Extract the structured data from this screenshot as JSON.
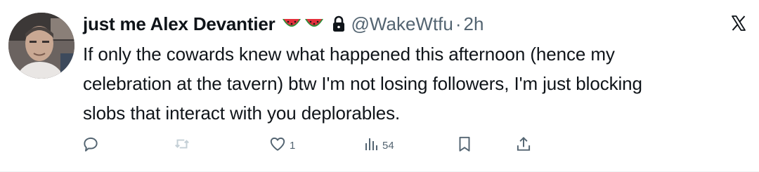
{
  "tweet": {
    "author": {
      "display_name": "just me Alex Devantier",
      "badges": [
        "watermelon-icon",
        "watermelon-icon"
      ],
      "protected_icon": "lock-icon",
      "handle": "@WakeWtfu",
      "separator": "·",
      "time": "2h"
    },
    "body_lines": [
      "If only the cowards knew what happened this afternoon (hence my",
      "celebration at the tavern) btw I'm not losing followers, I'm just blocking",
      "slobs that interact with you deplorables."
    ],
    "actions": {
      "reply": {
        "icon": "reply-icon",
        "count": ""
      },
      "repost": {
        "icon": "repost-icon",
        "count": ""
      },
      "like": {
        "icon": "heart-icon",
        "count": "1"
      },
      "views": {
        "icon": "views-icon",
        "count": "54"
      },
      "bookmark": {
        "icon": "bookmark-icon",
        "count": ""
      },
      "share": {
        "icon": "share-icon",
        "count": ""
      }
    },
    "close_icon": "x-logo-icon"
  },
  "colors": {
    "text_primary": "#0f1419",
    "text_secondary": "#536471",
    "repost_disabled": "#c4cfd6",
    "divider": "#eff3f4",
    "watermelon_red": "#e5303c",
    "watermelon_green": "#2f8f3a"
  }
}
